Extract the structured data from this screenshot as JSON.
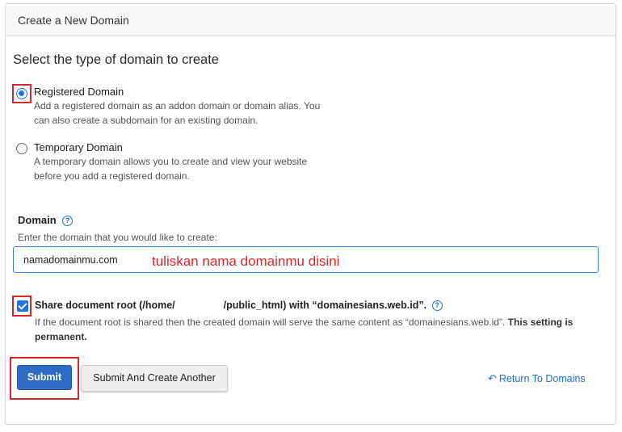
{
  "panel": {
    "title": "Create a New Domain"
  },
  "domain_type": {
    "heading": "Select the type of domain to create",
    "options": [
      {
        "label": "Registered Domain",
        "description": "Add a registered domain as an addon domain or domain alias. You can also create a subdomain for an existing domain.",
        "selected": true
      },
      {
        "label": "Temporary Domain",
        "description": "A temporary domain allows you to create and view your website before you add a registered domain.",
        "selected": false
      }
    ]
  },
  "domain_field": {
    "label": "Domain",
    "help_icon": "question-circle-icon",
    "hint": "Enter the domain that you would like to create:",
    "value": "namadomainmu.com",
    "annotation": "tuliskan nama domainmu disini"
  },
  "share_root": {
    "checked": true,
    "label_prefix": "Share document root (/home/",
    "label_suffix": "/public_html) with “domainesians.web.id”.",
    "description": "If the document root is shared then the created domain will serve the same content as “domainesians.web.id”.",
    "description_bold": "This setting is permanent."
  },
  "actions": {
    "submit": "Submit",
    "submit_create_another": "Submit And Create Another",
    "return_link": "Return To Domains",
    "return_icon": "undo-arrow-icon"
  },
  "colors": {
    "primary": "#2d6bc4",
    "link": "#1f6fc5",
    "annotation_red": "#e0262b"
  }
}
